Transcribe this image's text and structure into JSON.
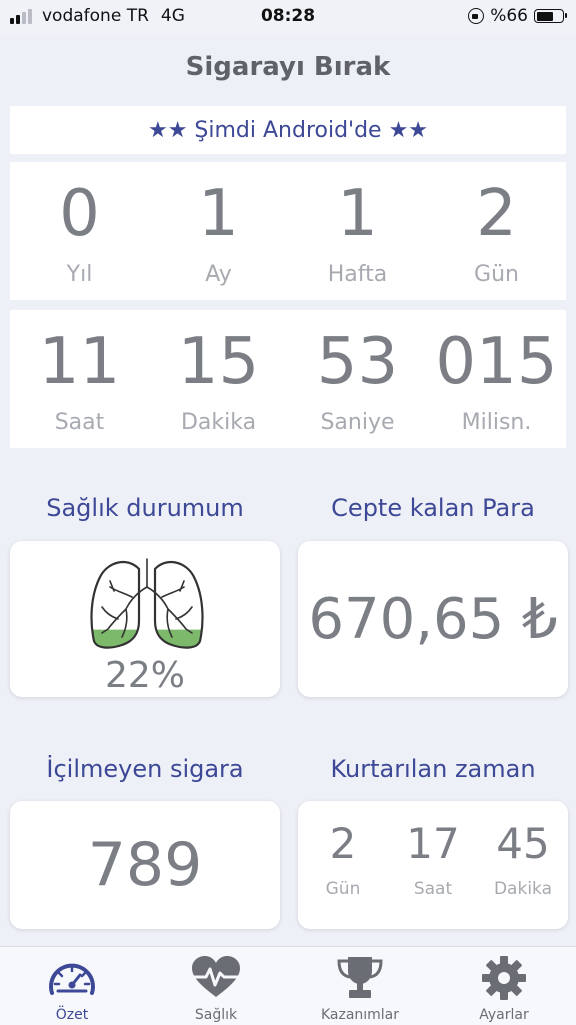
{
  "status": {
    "carrier": "vodafone TR",
    "network": "4G",
    "time": "08:28",
    "battery": "%66",
    "battery_level": 0.66
  },
  "header": {
    "title": "Sigarayı Bırak"
  },
  "banner": {
    "text": "★★ Şimdi Android'de ★★"
  },
  "elapsed_top": [
    {
      "value": "0",
      "label": "Yıl"
    },
    {
      "value": "1",
      "label": "Ay"
    },
    {
      "value": "1",
      "label": "Hafta"
    },
    {
      "value": "2",
      "label": "Gün"
    }
  ],
  "elapsed_bottom": [
    {
      "value": "11",
      "label": "Saat"
    },
    {
      "value": "15",
      "label": "Dakika"
    },
    {
      "value": "53",
      "label": "Saniye"
    },
    {
      "value": "015",
      "label": "Milisn."
    }
  ],
  "health": {
    "title": "Sağlık durumum",
    "percent": "22%",
    "icon": "lungs-icon"
  },
  "money": {
    "title": "Cepte kalan Para",
    "value": "670,65 ₺"
  },
  "cigarettes": {
    "title": "İçilmeyen sigara",
    "value": "789"
  },
  "saved_time": {
    "title": "Kurtarılan zaman",
    "items": [
      {
        "value": "2",
        "label": "Gün"
      },
      {
        "value": "17",
        "label": "Saat"
      },
      {
        "value": "45",
        "label": "Dakika"
      }
    ]
  },
  "tabs": [
    {
      "label": "Özet",
      "icon": "speedometer-icon",
      "active": true
    },
    {
      "label": "Sağlık",
      "icon": "heart-pulse-icon",
      "active": false
    },
    {
      "label": "Kazanımlar",
      "icon": "trophy-icon",
      "active": false
    },
    {
      "label": "Ayarlar",
      "icon": "gear-icon",
      "active": false
    }
  ],
  "colors": {
    "accent": "#3d4896",
    "value_text": "#7b7e85",
    "label_text": "#a7aab0",
    "lung_fill": "#7cb96b",
    "background": "#eef0f7"
  }
}
